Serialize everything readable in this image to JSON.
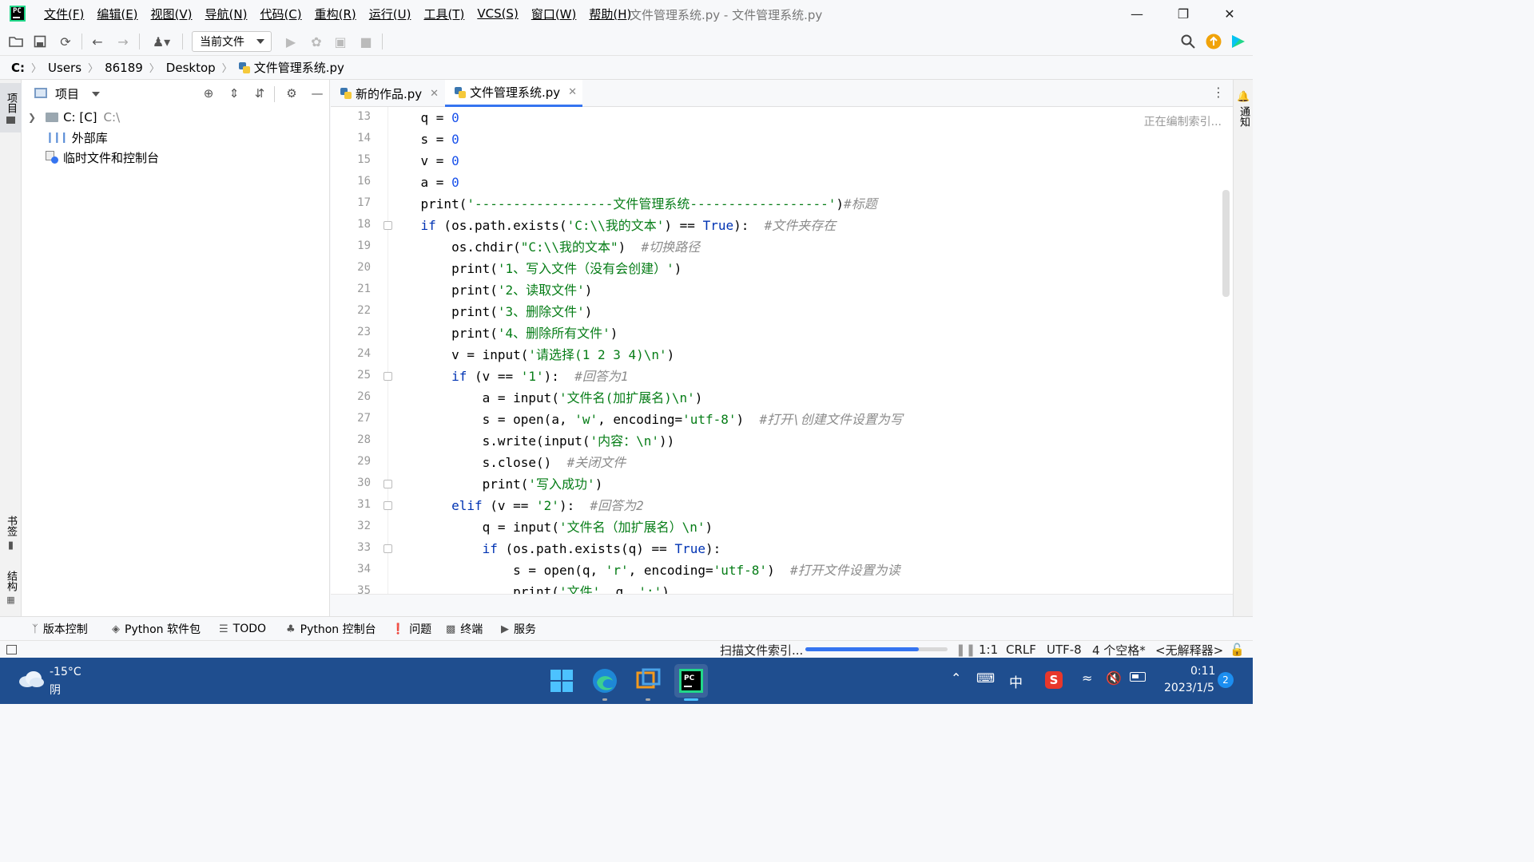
{
  "app": {
    "logo_text": "PC",
    "window_title": "文件管理系统.py - 文件管理系统.py"
  },
  "menu": [
    "文件(F)",
    "编辑(E)",
    "视图(V)",
    "导航(N)",
    "代码(C)",
    "重构(R)",
    "运行(U)",
    "工具(T)",
    "VCS(S)",
    "窗口(W)",
    "帮助(H)"
  ],
  "toolbar": {
    "run_config": "当前文件",
    "icons": [
      "open-folder-icon",
      "save-icon",
      "sync-icon",
      "back-icon",
      "forward-icon",
      "user-icon",
      "run-icon",
      "debug-icon",
      "coverage-icon",
      "stop-icon",
      "search-icon",
      "update-icon",
      "jetbrains-icon"
    ]
  },
  "breadcrumb": [
    "C:",
    "Users",
    "86189",
    "Desktop",
    "文件管理系统.py"
  ],
  "left_stripe": {
    "project": "项目",
    "bookmarks": "书签",
    "structure": "结构"
  },
  "right_stripe": {
    "notifications": "通知"
  },
  "project_panel": {
    "title": "项目",
    "tree": [
      {
        "label": "C: [C]",
        "sub": "C:\\"
      },
      {
        "label": "外部库"
      },
      {
        "label": "临时文件和控制台"
      }
    ]
  },
  "editor": {
    "tabs": [
      {
        "label": "新的作品.py",
        "active": false
      },
      {
        "label": "文件管理系统.py",
        "active": true
      }
    ],
    "index_hint": "正在编制索引...",
    "lines": [
      {
        "n": "13",
        "text": "    q = 0"
      },
      {
        "n": "14",
        "text": "    s = 0"
      },
      {
        "n": "15",
        "text": "    v = 0"
      },
      {
        "n": "16",
        "text": "    a = 0"
      },
      {
        "n": "17",
        "text": "    print('------------------文件管理系统------------------')#标题"
      },
      {
        "n": "18",
        "text": "    if (os.path.exists('C:\\\\我的文本') == True):  #文件夹存在"
      },
      {
        "n": "19",
        "text": "        os.chdir(\"C:\\\\我的文本\")  #切换路径"
      },
      {
        "n": "20",
        "text": "        print('1、写入文件（没有会创建）')"
      },
      {
        "n": "21",
        "text": "        print('2、读取文件')"
      },
      {
        "n": "22",
        "text": "        print('3、删除文件')"
      },
      {
        "n": "23",
        "text": "        print('4、删除所有文件')"
      },
      {
        "n": "24",
        "text": "        v = input('请选择(1 2 3 4)\\n')"
      },
      {
        "n": "25",
        "text": "        if (v == '1'):  #回答为1"
      },
      {
        "n": "26",
        "text": "            a = input('文件名(加扩展名)\\n')"
      },
      {
        "n": "27",
        "text": "            s = open(a, 'w', encoding='utf-8')  #打开\\创建文件设置为写"
      },
      {
        "n": "28",
        "text": "            s.write(input('内容：\\n'))"
      },
      {
        "n": "29",
        "text": "            s.close()  #关闭文件"
      },
      {
        "n": "30",
        "text": "            print('写入成功')"
      },
      {
        "n": "31",
        "text": "        elif (v == '2'):  #回答为2"
      },
      {
        "n": "32",
        "text": "            q = input('文件名（加扩展名）\\n')"
      },
      {
        "n": "33",
        "text": "            if (os.path.exists(q) == True):"
      },
      {
        "n": "34",
        "text": "                s = open(q, 'r', encoding='utf-8')  #打开文件设置为读"
      },
      {
        "n": "35",
        "text": "                print('文件', q, ':')"
      }
    ]
  },
  "tool_windows": [
    {
      "label": "版本控制",
      "icon": "vcs-icon"
    },
    {
      "label": "Python 软件包",
      "icon": "packages-icon"
    },
    {
      "label": "TODO",
      "icon": "todo-icon"
    },
    {
      "label": "Python 控制台",
      "icon": "python-console-icon"
    },
    {
      "label": "问题",
      "icon": "problems-icon"
    },
    {
      "label": "终端",
      "icon": "terminal-icon"
    },
    {
      "label": "服务",
      "icon": "services-icon"
    }
  ],
  "status_bar": {
    "indexing": "扫描文件索引...",
    "progress": 0.8,
    "position": "1:1",
    "line_sep": "CRLF",
    "encoding": "UTF-8",
    "indent": "4 个空格*",
    "interpreter": "<无解释器>"
  },
  "taskbar": {
    "temperature": "-15°C",
    "weather": "阴",
    "ime": "中",
    "time": "0:11",
    "date": "2023/1/5",
    "notifications": "2"
  },
  "colors": {
    "keyword": "#0033b3",
    "string": "#067d17",
    "number": "#1750eb",
    "comment": "#8c8c8c",
    "accent": "#3574f0",
    "taskbar": "#1f4e8f"
  }
}
